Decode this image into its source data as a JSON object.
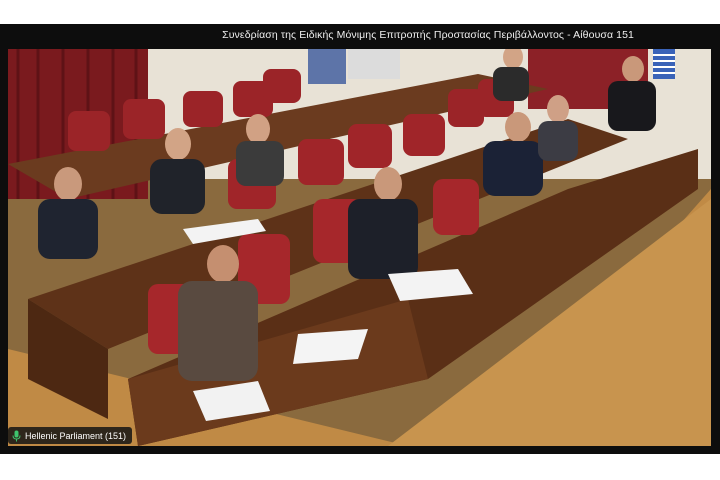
{
  "window": {
    "title": "Συνεδρίαση της Ειδικής Μόνιμης Επιτροπής Προστασίας Περιβάλλοντος - Αίθουσα 151"
  },
  "channel": {
    "label": "Hellenic Parliament (151)",
    "icon": "microphone-icon",
    "icon_color": "#3ec46d"
  },
  "colors": {
    "background": "#0d0d0d",
    "title_text": "#f0f0f0"
  }
}
